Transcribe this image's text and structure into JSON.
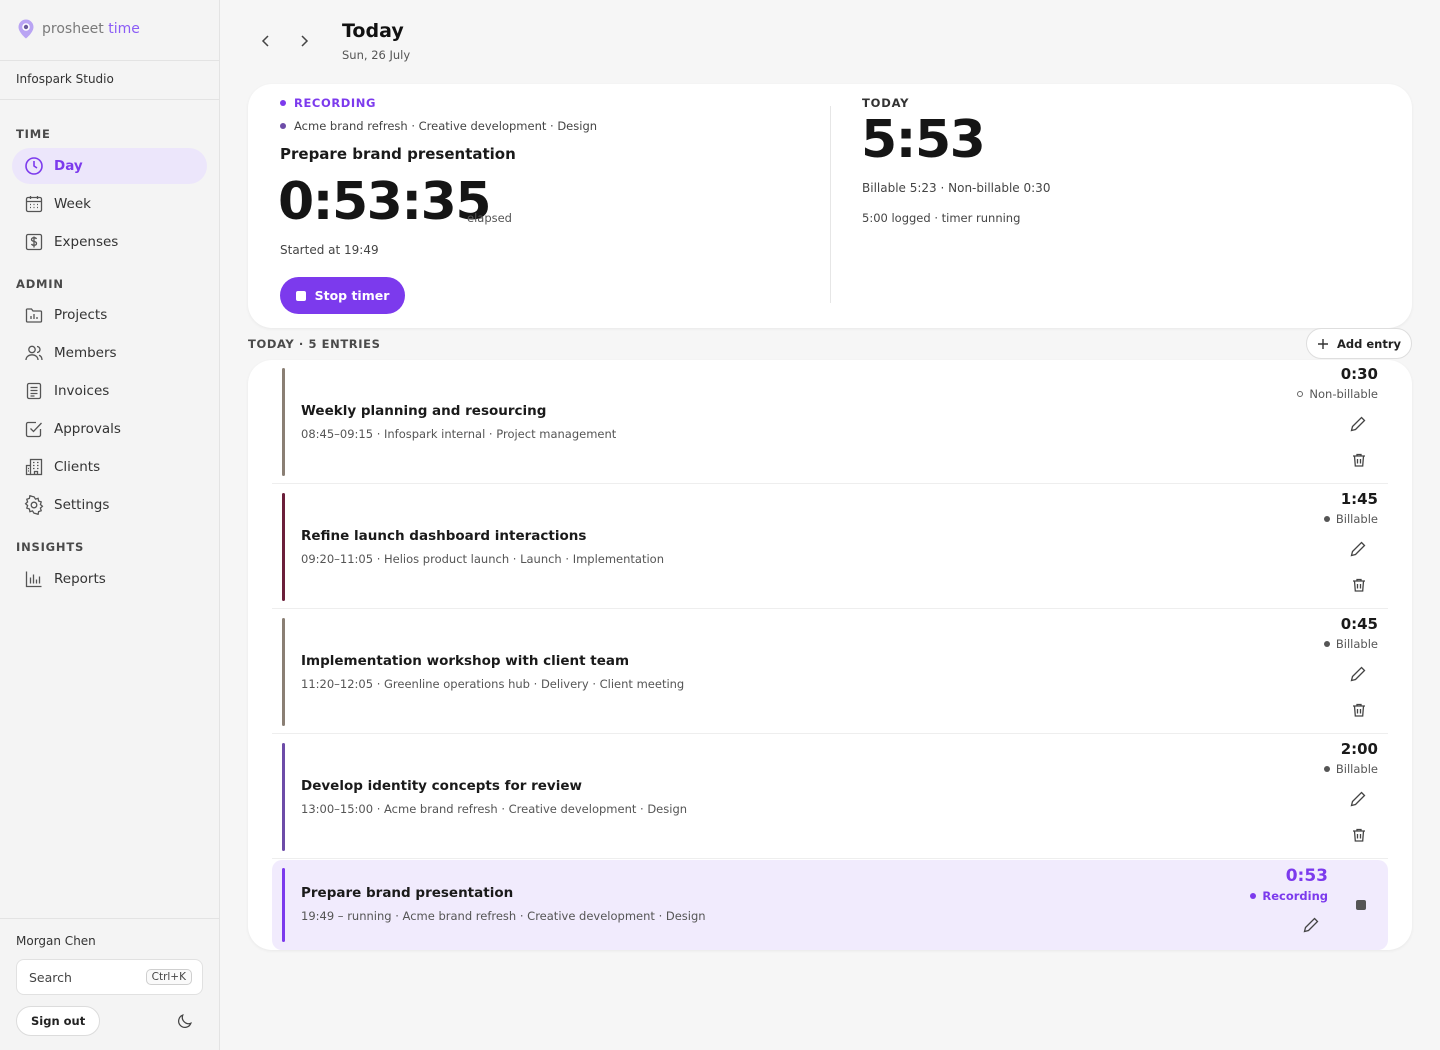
{
  "app": {
    "brand_main": "prosheet",
    "brand_accent": "time",
    "org": "Infospark Studio",
    "accent_color": "#7c3aed"
  },
  "sidebar": {
    "sections": [
      {
        "label": "TIME",
        "items": [
          {
            "label": "Day",
            "icon": "clock-icon",
            "active": true
          },
          {
            "label": "Week",
            "icon": "calendar-icon"
          },
          {
            "label": "Expenses",
            "icon": "dollar-icon"
          }
        ]
      },
      {
        "label": "ADMIN",
        "items": [
          {
            "label": "Projects",
            "icon": "folder-chart-icon"
          },
          {
            "label": "Members",
            "icon": "users-icon"
          },
          {
            "label": "Invoices",
            "icon": "document-icon"
          },
          {
            "label": "Approvals",
            "icon": "check-square-icon"
          },
          {
            "label": "Clients",
            "icon": "building-icon"
          },
          {
            "label": "Settings",
            "icon": "gear-icon"
          }
        ]
      },
      {
        "label": "INSIGHTS",
        "items": [
          {
            "label": "Reports",
            "icon": "bar-chart-icon"
          }
        ]
      }
    ],
    "user_name": "Morgan Chen",
    "search_label": "Search",
    "search_shortcut": "Ctrl+K",
    "sign_out_label": "Sign out"
  },
  "header": {
    "title": "Today",
    "date": "Sun, 26 July"
  },
  "recording": {
    "label": "RECORDING",
    "meta": "Acme brand refresh · Creative development · Design",
    "task": "Prepare brand presentation",
    "elapsed": "0:53:35",
    "elapsed_label": "elapsed",
    "started": "Started at 19:49",
    "stop_label": "Stop timer"
  },
  "today": {
    "label": "TODAY",
    "total": "5:53",
    "billable_summary": "Billable 5:23 · Non-billable 0:30",
    "logged_summary": "5:00 logged · timer running"
  },
  "entries_header": "TODAY · 5 ENTRIES",
  "add_entry_label": "Add entry",
  "entries": [
    {
      "title": "Weekly planning and resourcing",
      "meta": "08:45–09:15 · Infospark internal · Project management",
      "duration": "0:30",
      "status": "Non-billable",
      "bar_color": "#8a7f74"
    },
    {
      "title": "Refine launch dashboard interactions",
      "meta": "09:20–11:05 · Helios product launch · Launch · Implementation",
      "duration": "1:45",
      "status": "Billable",
      "bar_color": "#6b1f3a"
    },
    {
      "title": "Implementation workshop with client team",
      "meta": "11:20–12:05 · Greenline operations hub · Delivery · Client meeting",
      "duration": "0:45",
      "status": "Billable",
      "bar_color": "#8a7f74"
    },
    {
      "title": "Develop identity concepts for review",
      "meta": "13:00–15:00 · Acme brand refresh · Creative development · Design",
      "duration": "2:00",
      "status": "Billable",
      "bar_color": "#6d4ca8"
    },
    {
      "title": "Prepare brand presentation",
      "meta": "19:49 – running · Acme brand refresh · Creative development · Design",
      "duration": "0:53",
      "status": "Recording",
      "bar_color": "#7c3aed"
    }
  ]
}
